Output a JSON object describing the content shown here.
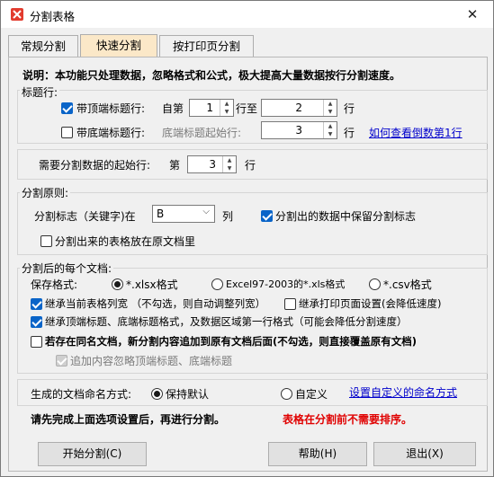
{
  "window": {
    "title": "分割表格"
  },
  "tabs": [
    "常规分割",
    "快速分割",
    "按打印页分割"
  ],
  "notice": "说明：本功能只处理数据，忽略格式和公式，极大提高大量数据按行分割速度。",
  "header_rows": {
    "group_label": "标题行:",
    "top_checkbox": "带顶端标题行:",
    "from_label": "自第",
    "from_value": "1",
    "to_label": "行至",
    "to_value": "2",
    "row_unit": "行",
    "bottom_checkbox": "带底端标题行:",
    "bottom_start_label": "底端标题起始行:",
    "bottom_start_value": "3",
    "bottom_row_unit": "行",
    "help_link": "如何查看倒数第1行"
  },
  "start_row": {
    "label": "需要分割数据的起始行:",
    "prefix": "第",
    "value": "3",
    "unit": "行"
  },
  "principle": {
    "group_label": "分割原则:",
    "key_label": "分割标志（关键字)在",
    "key_value": "B",
    "column_unit": "列",
    "keep_flag": "分割出的数据中保留分割标志",
    "in_original": "分割出来的表格放在原文档里"
  },
  "docs": {
    "group_label": "分割后的每个文档:",
    "save_format_label": "保存格式:",
    "formats": [
      "*.xlsx格式",
      "Excel97-2003的*.xls格式",
      "*.csv格式"
    ],
    "inherit_width": "继承当前表格列宽  （不勾选，则自动调整列宽）",
    "inherit_print": "继承打印页面设置(会降低速度)",
    "inherit_title_format": "继承顶端标题、底端标题格式，及数据区域第一行格式（可能会降低分割速度）",
    "append_if_exists": "若存在同名文档，新分割内容追加到原有文档后面(不勾选，则直接覆盖原有文档)",
    "append_with_titles": "追加内容忽略顶端标题、底端标题"
  },
  "naming": {
    "label": "生成的文档命名方式:",
    "default_option": "保持默认",
    "custom_option": "自定义",
    "custom_link": "设置自定义的命名方式"
  },
  "footer_notes": {
    "left": "请先完成上面选项设置后，再进行分割。",
    "right": "表格在分割前不需要排序。"
  },
  "buttons": {
    "start": "开始分割(C)",
    "help": "帮助(H)",
    "exit": "退出(X)"
  },
  "colors": {
    "link": "#0000cc",
    "warning": "#e00000",
    "active_tab": "#fbe8c8",
    "checkbox_checked": "#0a64c8"
  }
}
